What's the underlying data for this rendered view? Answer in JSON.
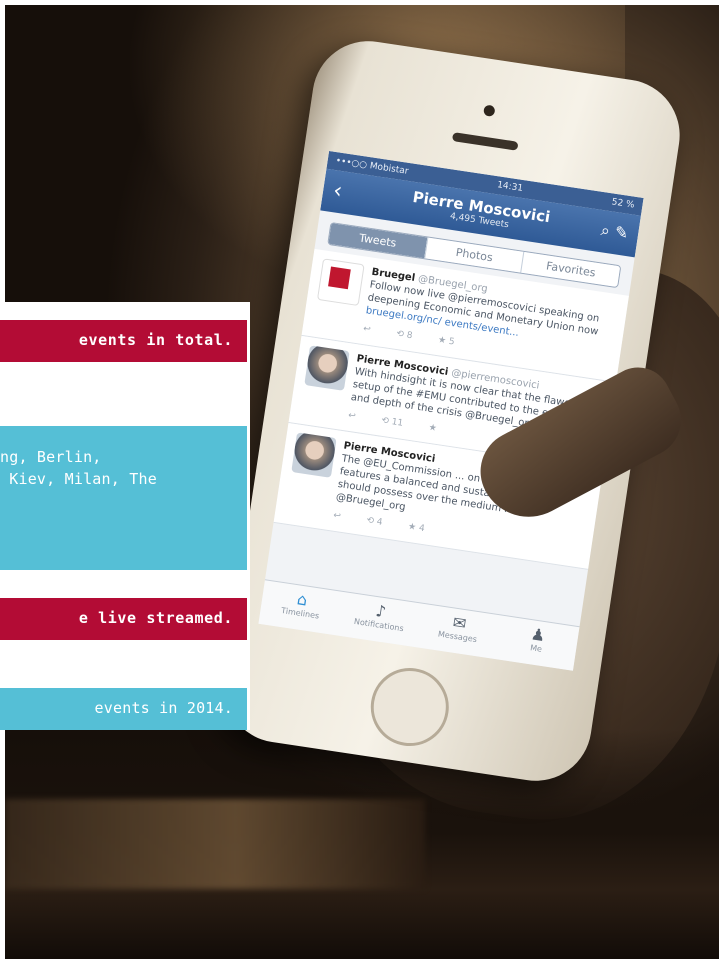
{
  "panel": {
    "facts": [
      {
        "text": "events in total.",
        "style": "red"
      },
      {
        "text": "ng, Berlin,\n Kiev, Milan, The",
        "style": "blue"
      },
      {
        "text": "e live streamed.",
        "style": "red"
      },
      {
        "text": "events in 2014.",
        "style": "blue"
      }
    ]
  },
  "phone": {
    "status": {
      "carrier": "•••○○ Mobistar",
      "time": "14:31",
      "battery": "52 %"
    },
    "profile": {
      "name": "Pierre Moscovici",
      "tweets_count": "4,495 Tweets"
    },
    "tabs": [
      "Tweets",
      "Photos",
      "Favorites"
    ],
    "tweets": [
      {
        "author": "Bruegel",
        "handle": "@Bruegel_org",
        "text": "Follow now live @pierremoscovici speaking on deepening Economic and Monetary Union now",
        "link": "bruegel.org/nc/ events/event...",
        "actions": [
          "↩",
          "⟲ 8",
          "★ 5"
        ]
      },
      {
        "author": "Pierre Moscovici",
        "handle": "@pierremoscovici",
        "text": "With hindsight it is now clear that the flawed setup of the #EMU contributed to the emergence and depth of the crisis @Bruegel_org",
        "link": "",
        "actions": [
          "↩",
          "⟲ 11",
          "★"
        ]
      },
      {
        "author": "Pierre Moscovici",
        "handle": "",
        "text": "The @EU_Commission ... on the main broad features a balanced and sustainable #EMU should possess over the medium run @Bruegel_org",
        "link": "",
        "actions": [
          "↩",
          "⟲ 4",
          "★ 4"
        ]
      }
    ],
    "tabbar": [
      "Timelines",
      "Notifications",
      "Messages",
      "Me"
    ]
  }
}
